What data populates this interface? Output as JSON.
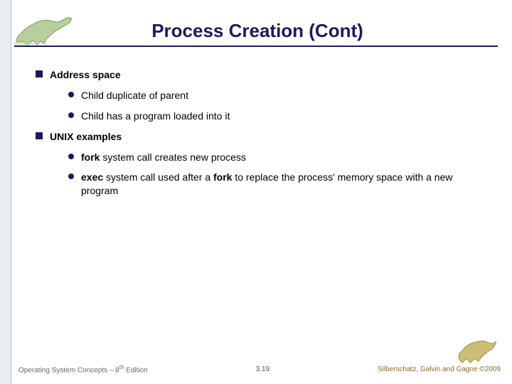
{
  "title": "Process Creation (Cont)",
  "bullets": {
    "b1": "Address space",
    "b1a": "Child duplicate of parent",
    "b1b": "Child has a program loaded into it",
    "b2": "UNIX examples",
    "b2a_kw1": "fork",
    "b2a_rest": " system call creates new process",
    "b2b_kw1": "exec",
    "b2b_mid": " system call used after a ",
    "b2b_kw2": "fork",
    "b2b_rest": " to replace the process' memory space with a new program"
  },
  "footer": {
    "left_a": "Operating System Concepts – 8",
    "left_sup": "th",
    "left_b": " Edition",
    "center": "3.19",
    "right": "Silberschatz, Galvin and Gagne ©2009"
  }
}
